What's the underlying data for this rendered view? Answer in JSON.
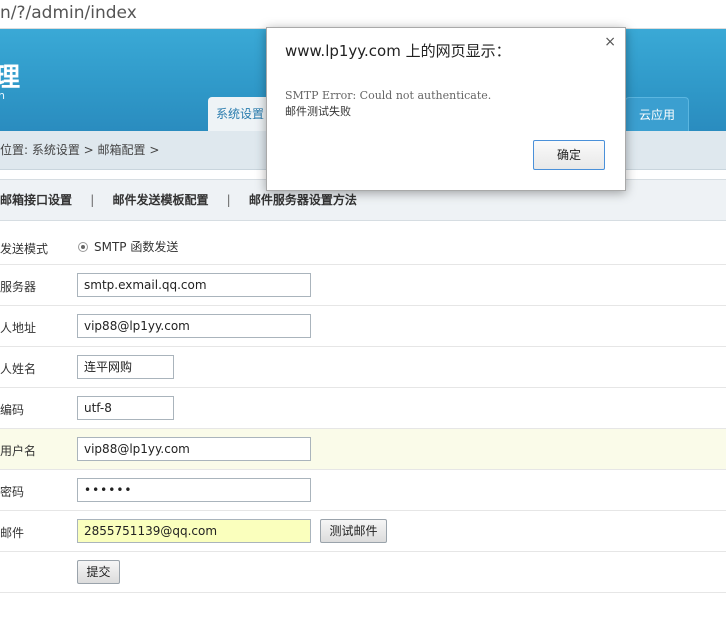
{
  "browser": {
    "address": "n/?/admin/index"
  },
  "header": {
    "logo_char": "理",
    "logo_sub": "n",
    "tabs": [
      {
        "label": "系统设置"
      },
      {
        "label": "云应用"
      }
    ]
  },
  "breadcrumb": "位置: 系统设置 > 邮箱配置 >",
  "subnav": {
    "items": [
      "邮箱接口设置",
      "邮件发送模板配置",
      "邮件服务器设置方法"
    ],
    "separator": "|"
  },
  "form": {
    "send_mode": {
      "label": "发送模式",
      "option": "SMTP 函数发送"
    },
    "server": {
      "label": "服务器",
      "value": "smtp.exmail.qq.com"
    },
    "sender_address": {
      "label": "人地址",
      "value": "vip88@lp1yy.com"
    },
    "sender_name": {
      "label": "人姓名",
      "value": "连平网购"
    },
    "encoding": {
      "label": "编码",
      "value": "utf-8"
    },
    "username": {
      "label": "用户名",
      "value": "vip88@lp1yy.com"
    },
    "password": {
      "label": "密码",
      "value": "••••••"
    },
    "test_email": {
      "label": "邮件",
      "value": "2855751139@qq.com",
      "button": "测试邮件"
    },
    "submit": "提交"
  },
  "dialog": {
    "title": "www.lp1yy.com 上的网页显示：",
    "close": "×",
    "message_line1": "SMTP Error: Could not authenticate.",
    "message_line2": "邮件测试失败",
    "ok": "确定"
  }
}
